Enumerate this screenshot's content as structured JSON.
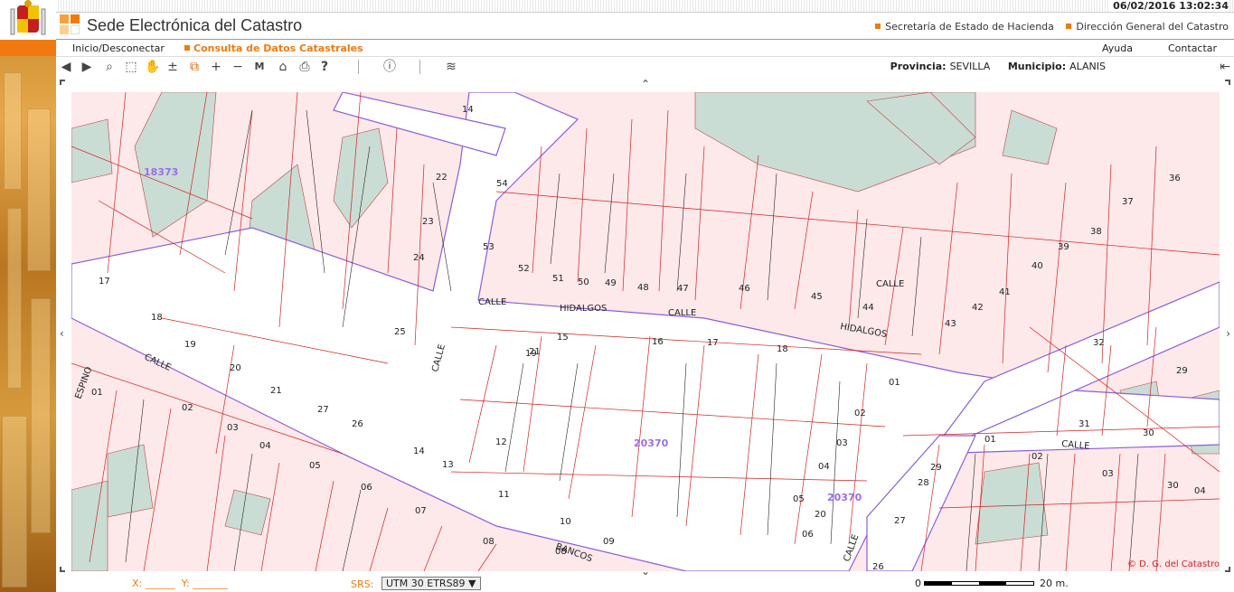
{
  "header": {
    "datetime": "06/02/2016  13:02:34",
    "title": "Sede Electrónica del Catastro",
    "links": [
      "Secretaría de Estado de Hacienda",
      "Dirección General del Catastro"
    ]
  },
  "nav": {
    "home": "Inicio/Desconectar",
    "active": "Consulta de Datos Catastrales",
    "help": "Ayuda",
    "contact": "Contactar"
  },
  "toolbar": {
    "icons": [
      "back-icon",
      "forward-icon",
      "zoom-icon",
      "cube-icon",
      "hand-icon",
      "zoom-extent-icon",
      "select-icon",
      "zoom-in-icon",
      "zoom-out-icon",
      "marker-m-icon",
      "home-map-icon",
      "print-icon",
      "help-icon",
      "info-icon",
      "layers-icon"
    ],
    "province_label": "Provincia:",
    "province": "SEVILLA",
    "municipality_label": "Municipio:",
    "municipality": "ALANIS"
  },
  "map": {
    "colors": {
      "parcel": "#fde8ea",
      "courtyard": "#c9ddd4",
      "street": "#ffffff",
      "parcel_line": "#d62020",
      "block_line": "#9060e0",
      "number": "#1a1aa0",
      "label": "#222222"
    },
    "street_labels": [
      "CALLE",
      "HIDALGOS",
      "CALLE",
      "HIDALGOS",
      "CALLE",
      "CALLE",
      "CALLE",
      "CALLE",
      "BANCOS",
      "CALLE",
      "ESPINO"
    ],
    "block_ids": [
      "18373",
      "20370",
      "20370"
    ],
    "parcel_numbers": [
      "14",
      "22",
      "23",
      "24",
      "25",
      "17",
      "18",
      "19",
      "20",
      "21",
      "27",
      "26",
      "01",
      "02",
      "03",
      "04",
      "05",
      "06",
      "07",
      "08",
      "09",
      "10",
      "11",
      "12",
      "13",
      "14",
      "15",
      "16",
      "17",
      "18",
      "19",
      "21",
      "43",
      "42",
      "41",
      "40",
      "39",
      "38",
      "37",
      "36",
      "44",
      "45",
      "46",
      "47",
      "48",
      "49",
      "50",
      "51",
      "52",
      "53",
      "54",
      "01",
      "02",
      "03",
      "04",
      "05",
      "06",
      "29",
      "28",
      "27",
      "26",
      "30",
      "31",
      "32",
      "29",
      "30",
      "04",
      "03",
      "02",
      "01",
      "20",
      "08"
    ],
    "copyright": "© D. G. del Catastro"
  },
  "bottom": {
    "x_label": "X: ______",
    "y_label": "Y: _______",
    "srs_label": "SRS:",
    "srs_value": "UTM 30 ETRS89",
    "scale_start": "0",
    "scale_end": "20 m."
  }
}
